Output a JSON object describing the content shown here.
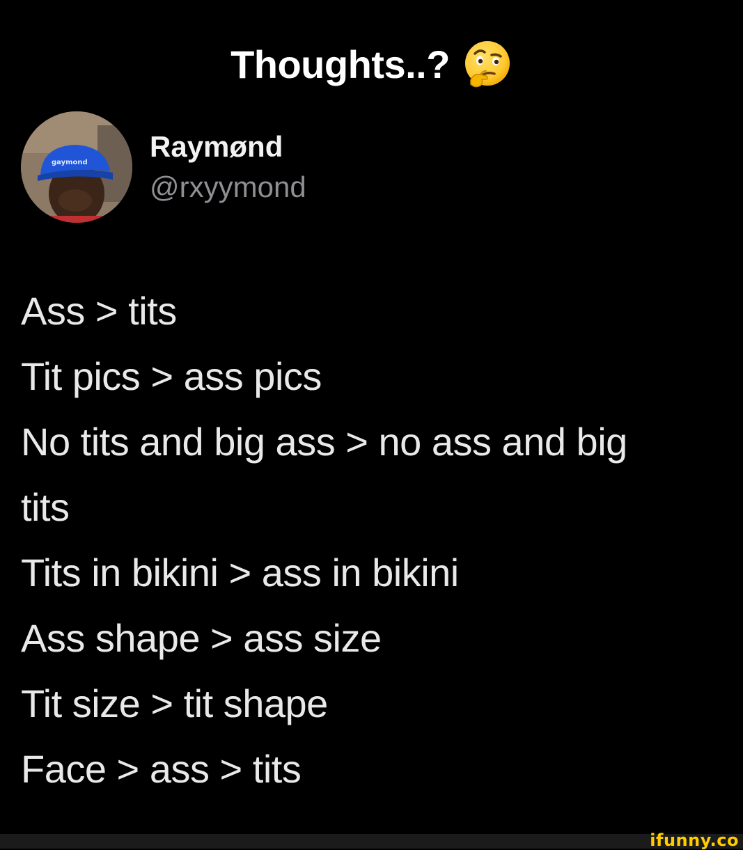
{
  "caption": {
    "text": "Thoughts..?",
    "emoji": "thinking-face-emoji"
  },
  "tweet": {
    "avatar": {
      "icon": "profile-photo",
      "cap_text": "gaymond"
    },
    "display_name": "Raymønd",
    "handle": "@rxyymond",
    "lines": [
      "Ass > tits",
      "Tit pics > ass pics",
      "No tits and big ass > no ass and big",
      "tits",
      "Tits in bikini > ass in bikini",
      "Ass shape > ass size",
      "Tit size > tit shape",
      "Face > ass > tits"
    ]
  },
  "watermark": {
    "text": "ifunny.co"
  },
  "colors": {
    "background": "#000000",
    "caption_text": "#ffffff",
    "tweet_text": "#e9e9ea",
    "handle_text": "#8e8e93",
    "watermark": "#ffcc00",
    "cap_blue": "#1f55d6"
  }
}
